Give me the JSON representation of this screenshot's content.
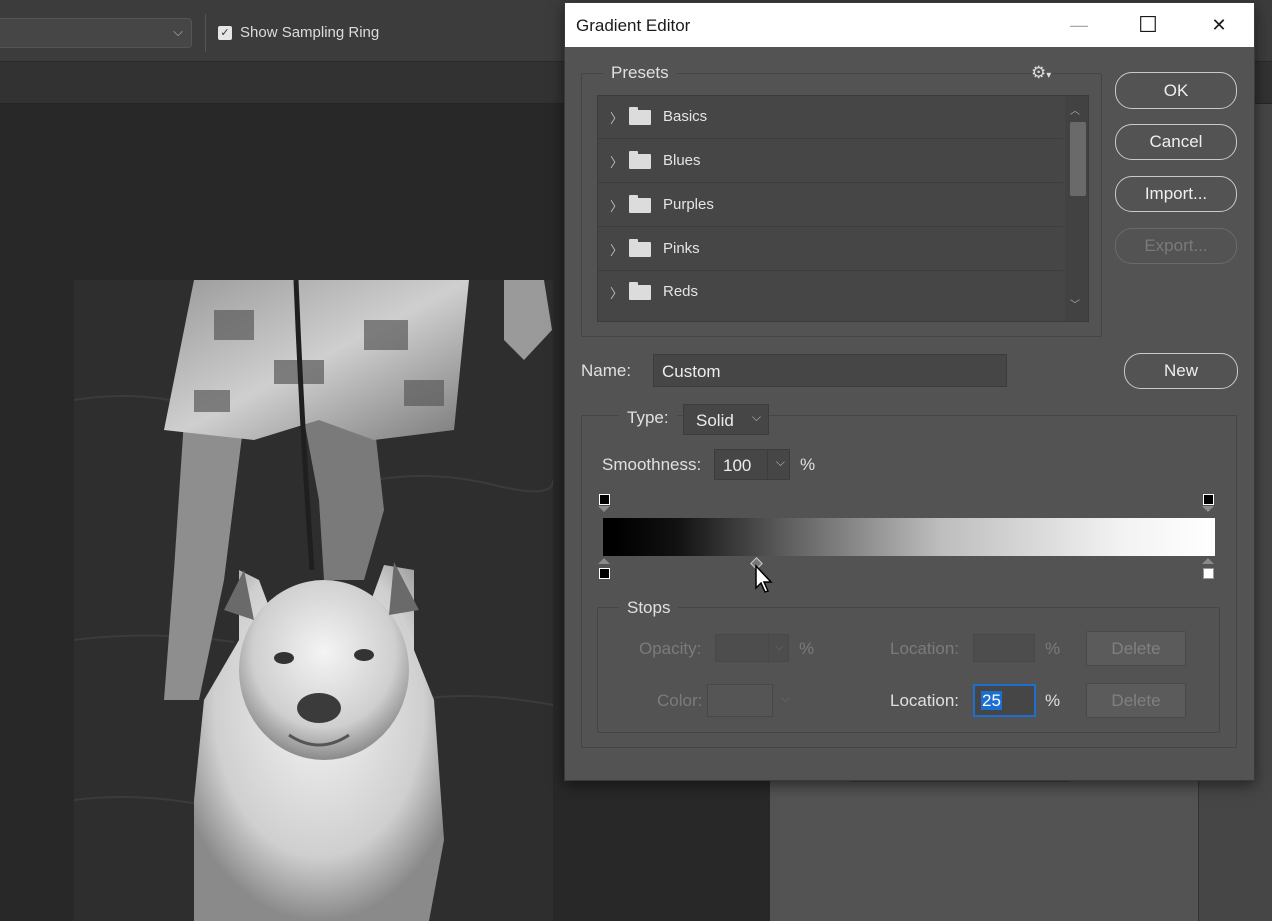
{
  "options_bar": {
    "show_sampling_ring_label": "Show Sampling Ring",
    "show_sampling_ring_checked": true
  },
  "dialog": {
    "title": "Gradient Editor",
    "window_controls": {
      "minimize": "—",
      "maximize": "☐",
      "close": "✕"
    },
    "presets": {
      "title": "Presets",
      "items": [
        {
          "label": "Basics"
        },
        {
          "label": "Blues"
        },
        {
          "label": "Purples"
        },
        {
          "label": "Pinks"
        },
        {
          "label": "Reds"
        }
      ]
    },
    "buttons": {
      "ok": "OK",
      "cancel": "Cancel",
      "import": "Import...",
      "export": "Export...",
      "new": "New"
    },
    "name": {
      "label": "Name:",
      "value": "Custom"
    },
    "type": {
      "label": "Type:",
      "value": "Solid"
    },
    "smoothness": {
      "label": "Smoothness:",
      "value": "100",
      "unit": "%"
    },
    "gradient": {
      "color_stops_percent": [
        0,
        100
      ],
      "midpoint_percent": 25,
      "start_color": "#000000",
      "end_color": "#ffffff"
    },
    "stops": {
      "title": "Stops",
      "opacity_label": "Opacity:",
      "opacity_unit": "%",
      "opacity_location_label": "Location:",
      "opacity_location_unit": "%",
      "opacity_delete": "Delete",
      "color_label": "Color:",
      "color_location_label": "Location:",
      "color_location_value": "25",
      "color_location_unit": "%",
      "color_delete": "Delete"
    }
  }
}
